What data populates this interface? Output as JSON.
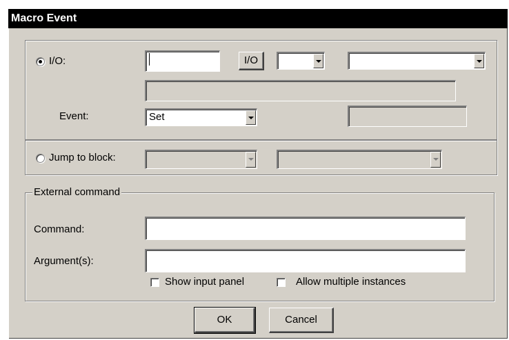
{
  "window": {
    "title": "Macro Event"
  },
  "io_section": {
    "radio_label": "I/O:",
    "radio_selected": true,
    "io_field_value": "",
    "io_button_label": "I/O",
    "small_dropdown_value": "",
    "wide_dropdown_value": "",
    "readonly_field_value": "",
    "event_label": "Event:",
    "event_dropdown_value": "Set",
    "event_side_field_value": ""
  },
  "jump_section": {
    "radio_label": "Jump to block:",
    "radio_selected": false,
    "block_dropdown_value": "",
    "block_detail_dropdown_value": ""
  },
  "external_command": {
    "legend": "External command",
    "command_label": "Command:",
    "command_value": "",
    "arguments_label": "Argument(s):",
    "arguments_value": "",
    "show_input_panel_label": "Show input panel",
    "show_input_panel_checked": false,
    "allow_multiple_label": "Allow multiple instances",
    "allow_multiple_checked": false
  },
  "buttons": {
    "ok_label": "OK",
    "cancel_label": "Cancel"
  }
}
